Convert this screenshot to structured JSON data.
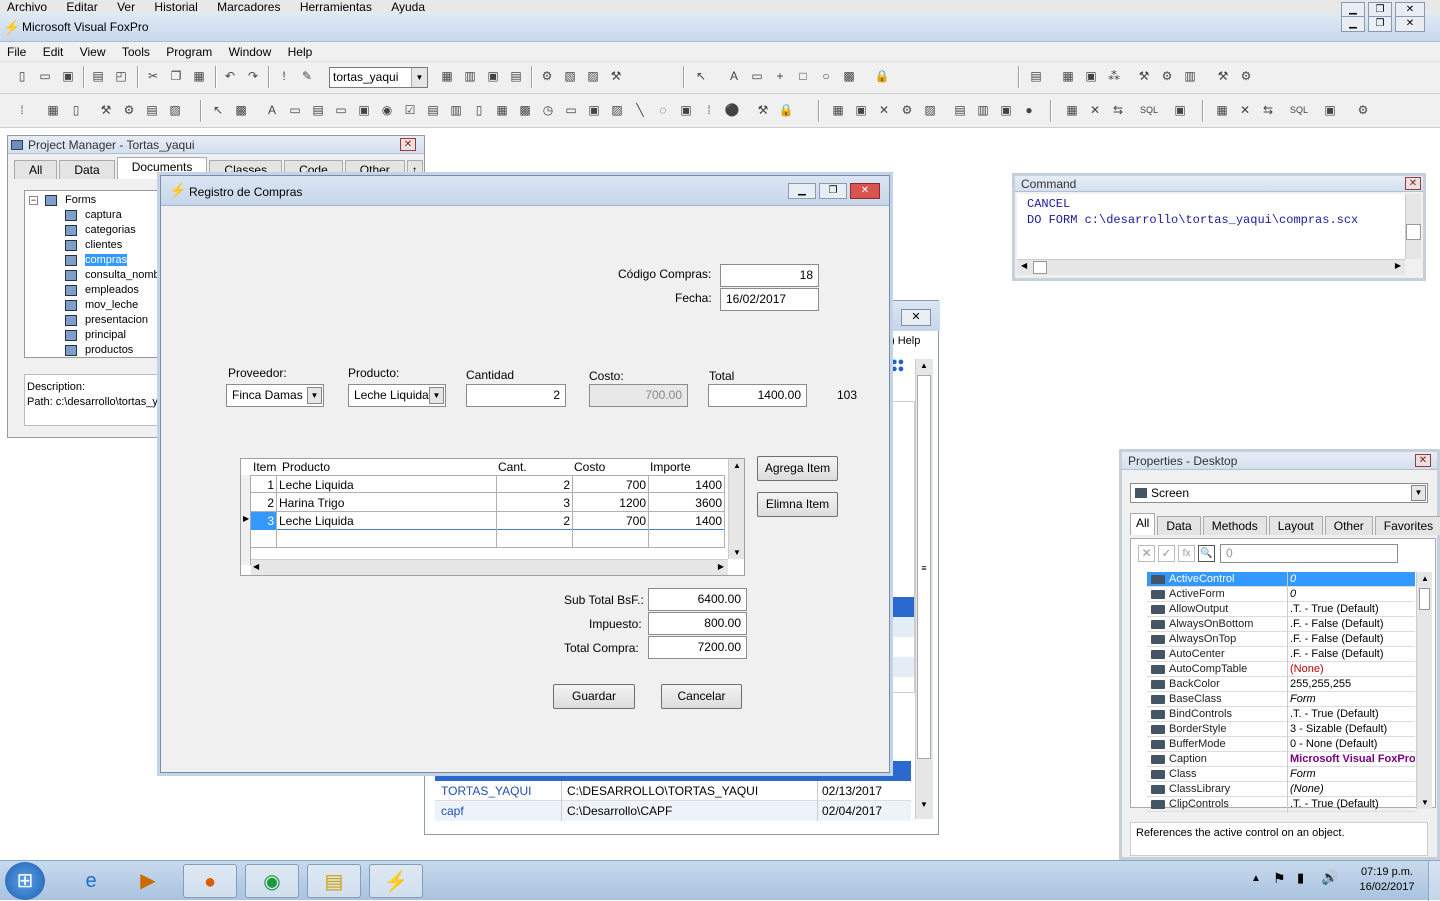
{
  "browser_menu": [
    "Archivo",
    "Editar",
    "Ver",
    "Historial",
    "Marcadores",
    "Herramientas",
    "Ayuda"
  ],
  "app": {
    "title": "Microsoft Visual FoxPro",
    "menu": [
      "File",
      "Edit",
      "View",
      "Tools",
      "Program",
      "Window",
      "Help"
    ],
    "toolbar_combo": "tortas_yaqui"
  },
  "project_manager": {
    "title": "Project Manager - Tortas_yaqui",
    "tabs": [
      "All",
      "Data",
      "Documents",
      "Classes",
      "Code",
      "Other"
    ],
    "active_tab": "Documents",
    "root": "Forms",
    "items": [
      "captura",
      "categorias",
      "clientes",
      "compras",
      "consulta_nombr",
      "empleados",
      "mov_leche",
      "presentacion",
      "principal",
      "productos"
    ],
    "selected": "compras",
    "description_label": "Description:",
    "path": "Path: c:\\desarrollo\\tortas_ya"
  },
  "command": {
    "title": "Command",
    "lines": [
      "CANCEL",
      "DO FORM c:\\desarrollo\\tortas_yaqui\\compras.scx"
    ]
  },
  "form": {
    "title": "Registro de Compras",
    "codigo_label": "Código Compras:",
    "codigo": "18",
    "fecha_label": "Fecha:",
    "fecha": "16/02/2017",
    "proveedor_label": "Proveedor:",
    "proveedor": "Finca Damas",
    "producto_label": "Producto:",
    "producto": "Leche Liquida",
    "cantidad_label": "Cantidad",
    "cantidad": "2",
    "costo_label": "Costo:",
    "costo": "700.00",
    "total_label": "Total",
    "total": "1400.00",
    "extra": "103",
    "grid": {
      "columns": [
        "Item",
        "Producto",
        "Cant.",
        "Costo",
        "Importe"
      ],
      "rows": [
        [
          "1",
          "Leche Liquida",
          "2",
          "700",
          "1400"
        ],
        [
          "2",
          "Harina Trigo",
          "3",
          "1200",
          "3600"
        ],
        [
          "3",
          "Leche Liquida",
          "2",
          "700",
          "1400"
        ]
      ]
    },
    "agrega_btn": "Agrega Item",
    "elimina_btn": "Elimna Item",
    "subtotal_label": "Sub Total BsF.:",
    "subtotal": "6400.00",
    "impuesto_label": "Impuesto:",
    "impuesto": "800.00",
    "totalcompra_label": "Total Compra:",
    "totalcompra": "7200.00",
    "guardar_btn": "Guardar",
    "cancelar_btn": "Cancelar"
  },
  "back_window": {
    "help_label": "Help",
    "rows": [
      [
        "TORTAS_YAQUI",
        "C:\\DESARROLLO\\TORTAS_YAQUI",
        "02/13/2017"
      ],
      [
        "capf",
        "C:\\Desarrollo\\CAPF",
        "02/04/2017"
      ]
    ]
  },
  "properties": {
    "title": "Properties - Desktop",
    "object": "Screen",
    "tabs": [
      "All",
      "Data",
      "Methods",
      "Layout",
      "Other",
      "Favorites"
    ],
    "active_tab": "All",
    "value_box": "0",
    "rows": [
      [
        "ActiveControl",
        "0"
      ],
      [
        "ActiveForm",
        "0"
      ],
      [
        "AllowOutput",
        ".T. - True (Default)"
      ],
      [
        "AlwaysOnBottom",
        ".F. - False (Default)"
      ],
      [
        "AlwaysOnTop",
        ".F. - False (Default)"
      ],
      [
        "AutoCenter",
        ".F. - False (Default)"
      ],
      [
        "AutoCompTable",
        "(None)"
      ],
      [
        "BackColor",
        "255,255,255"
      ],
      [
        "BaseClass",
        "Form"
      ],
      [
        "BindControls",
        ".T. - True (Default)"
      ],
      [
        "BorderStyle",
        "3 - Sizable (Default)"
      ],
      [
        "BufferMode",
        "0 - None (Default)"
      ],
      [
        "Caption",
        "Microsoft Visual FoxPro"
      ],
      [
        "Class",
        "Form"
      ],
      [
        "ClassLibrary",
        "(None)"
      ],
      [
        "ClipControls",
        ".T. - True (Default)"
      ]
    ],
    "description": "References the active control on an object."
  },
  "taskbar": {
    "time": "07:19 p.m.",
    "date": "16/02/2017"
  }
}
